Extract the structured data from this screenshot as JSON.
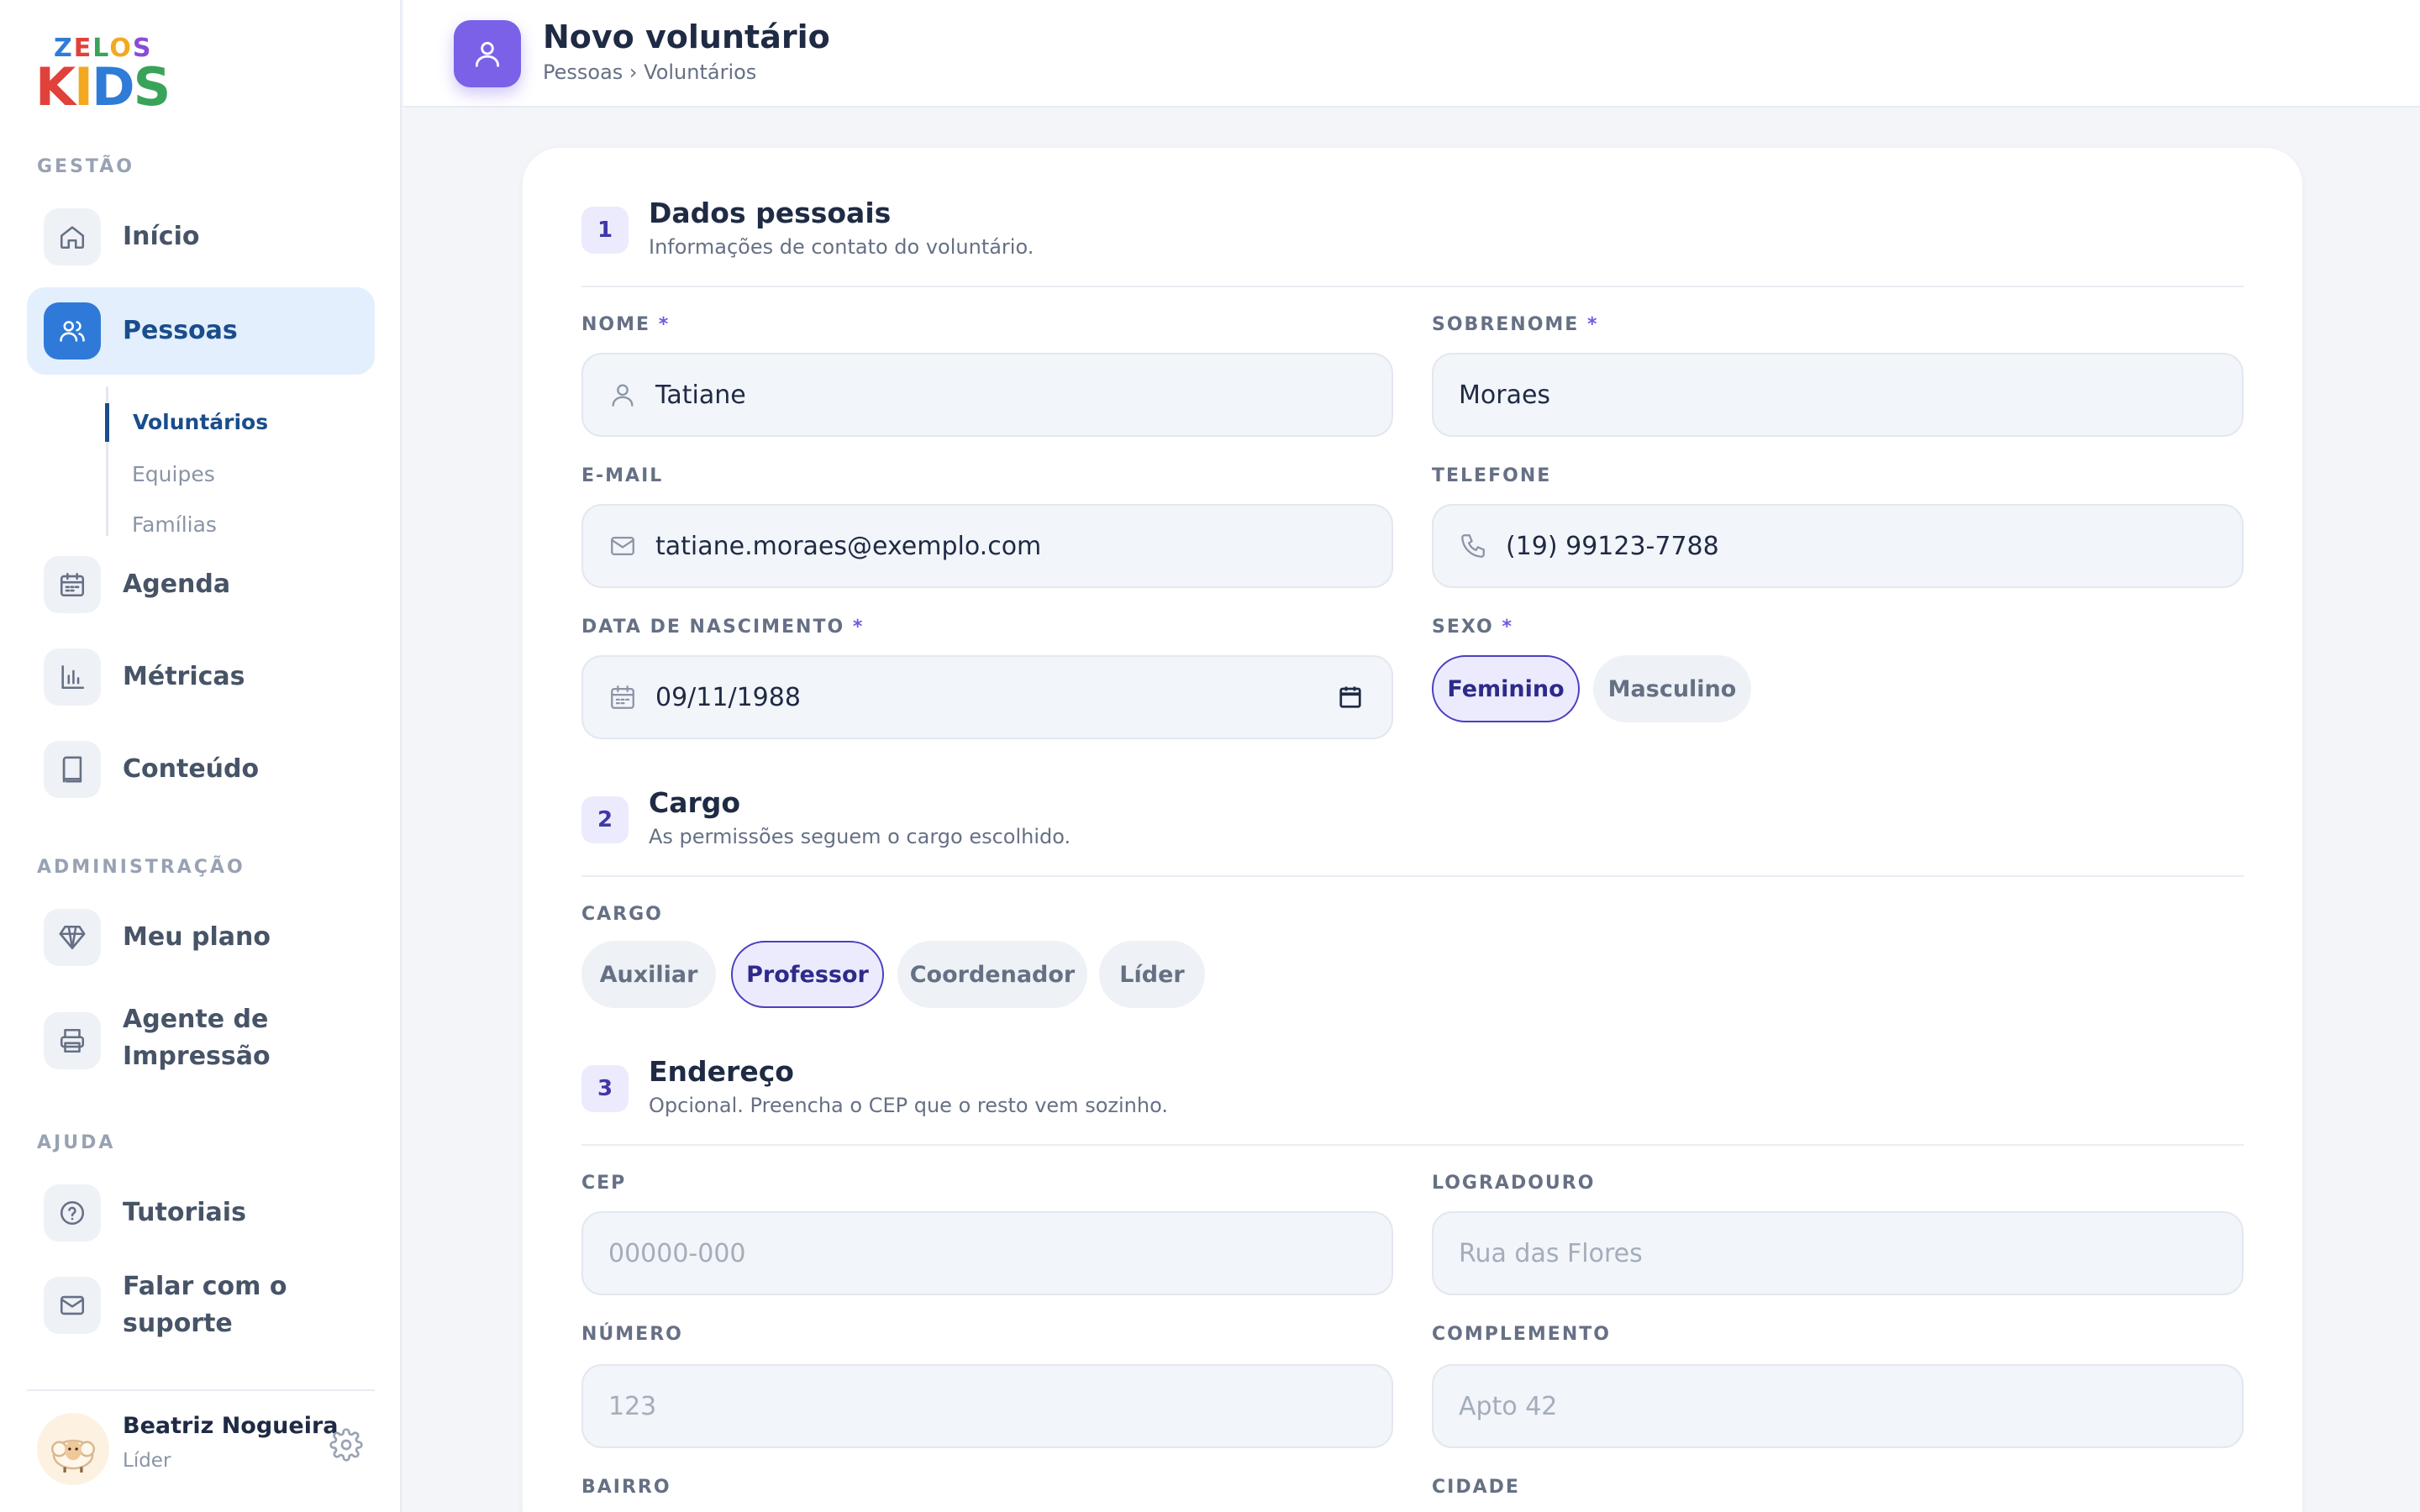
{
  "brand": {
    "line1": "ZELOS",
    "line2": "KIDS"
  },
  "sidebar": {
    "sections": {
      "gestao": "GESTÃO",
      "administracao": "ADMINISTRAÇÃO",
      "ajuda": "AJUDA"
    },
    "items": {
      "inicio": "Início",
      "pessoas": "Pessoas",
      "agenda": "Agenda",
      "metricas": "Métricas",
      "conteudo": "Conteúdo",
      "meu_plano": "Meu plano",
      "agente_line1": "Agente de",
      "agente_line2": "Impressão",
      "tutoriais": "Tutoriais",
      "suporte": "Falar com o suporte"
    },
    "subitems": [
      "Voluntários",
      "Equipes",
      "Famílias"
    ],
    "user": {
      "name": "Beatriz Nogueira",
      "role": "Líder"
    }
  },
  "header": {
    "title": "Novo voluntário",
    "breadcrumb": "Pessoas › Voluntários"
  },
  "form": {
    "personal": {
      "step": "1",
      "title": "Dados pessoais",
      "subtitle": "Informações de contato do voluntário.",
      "nome_label": "NOME",
      "nome_value": "Tatiane",
      "sobrenome_label": "SOBRENOME",
      "sobrenome_value": "Moraes",
      "email_label": "E-MAIL",
      "email_value": "tatiane.moraes@exemplo.com",
      "telefone_label": "TELEFONE",
      "telefone_value": "(19) 99123-7788",
      "nascimento_label": "DATA DE NASCIMENTO",
      "nascimento_value": "09/11/1988",
      "sexo_label": "SEXO",
      "sexo_options": [
        "Feminino",
        "Masculino"
      ],
      "sexo_selected": "Feminino",
      "required_mark": "*"
    },
    "cargo": {
      "step": "2",
      "title": "Cargo",
      "subtitle": "As permissões seguem o cargo escolhido.",
      "label": "CARGO",
      "options": [
        "Auxiliar",
        "Professor",
        "Coordenador",
        "Líder"
      ],
      "selected": "Professor"
    },
    "endereco": {
      "step": "3",
      "title": "Endereço",
      "subtitle": "Opcional. Preencha o CEP que o resto vem sozinho.",
      "cep_label": "CEP",
      "cep_placeholder": "00000-000",
      "logradouro_label": "LOGRADOURO",
      "logradouro_placeholder": "Rua das Flores",
      "numero_label": "NÚMERO",
      "numero_placeholder": "123",
      "complemento_label": "COMPLEMENTO",
      "complemento_placeholder": "Apto 42",
      "bairro_label": "BAIRRO",
      "cidade_label": "CIDADE"
    }
  },
  "colors": {
    "accent": "#7b61e8",
    "active_nav": "#2f7ad8",
    "chip_active_border": "#4a3fbf"
  },
  "icons": [
    "home-icon",
    "users-icon",
    "calendar-icon",
    "chart-icon",
    "book-icon",
    "diamond-icon",
    "printer-icon",
    "help-icon",
    "mail-icon",
    "gear-icon",
    "user-icon",
    "phone-icon"
  ]
}
